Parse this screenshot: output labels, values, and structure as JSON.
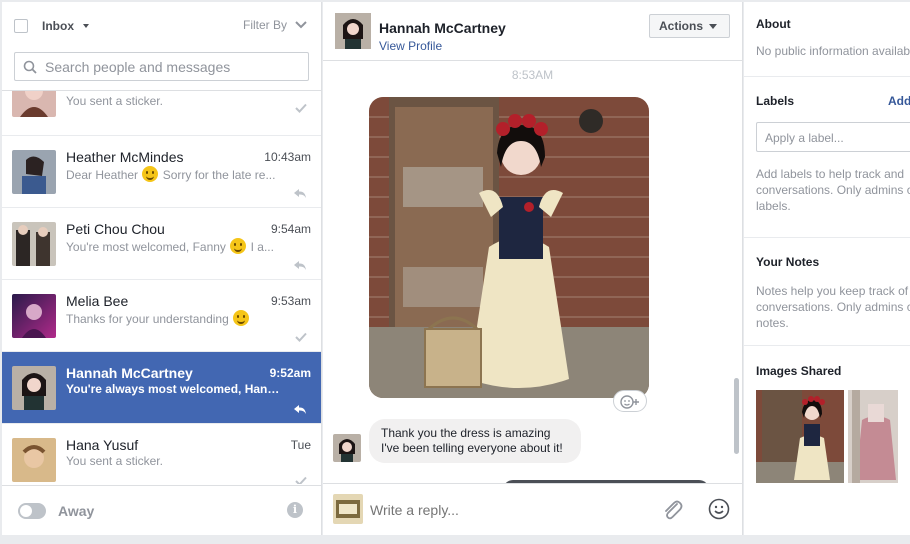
{
  "inbox": {
    "label": "Inbox",
    "filter_label": "Filter By",
    "search_placeholder": "Search people and messages",
    "threads": [
      {
        "name": "",
        "time": "",
        "preview": "You sent a sticker.",
        "status": "seen"
      },
      {
        "name": "Heather McMindes",
        "time": "10:43am",
        "preview_before": "Dear Heather",
        "preview_after": "Sorry for the late re...",
        "status": "replied"
      },
      {
        "name": "Peti Chou Chou",
        "time": "9:54am",
        "preview_before": "You're most welcomed, Fanny",
        "preview_after": "I a...",
        "status": "replied"
      },
      {
        "name": "Melia Bee",
        "time": "9:53am",
        "preview_before": "Thanks for your understanding",
        "preview_after": "",
        "status": "seen"
      },
      {
        "name": "Hannah McCartney",
        "time": "9:52am",
        "preview": "You're always most welcomed, Hann...",
        "status": "replied",
        "selected": true
      },
      {
        "name": "Hana Yusuf",
        "time": "Tue",
        "preview": "You sent a sticker.",
        "status": "seen"
      }
    ],
    "away_label": "Away"
  },
  "conversation": {
    "name": "Hannah McCartney",
    "view_profile": "View Profile",
    "actions_label": "Actions",
    "timestamp": "8:53AM",
    "message_line1": "Thank you the dress is amazing",
    "message_line2": "I've been telling everyone about it!",
    "reply_placeholder": "Write a reply..."
  },
  "details": {
    "about_title": "About",
    "about_text": "No public information available",
    "labels_title": "Labels",
    "labels_add": "Add",
    "label_placeholder": "Apply a label...",
    "labels_help_1": "Add labels to help track and",
    "labels_help_2": "conversations. Only admins c",
    "labels_help_3": "labels.",
    "notes_title": "Your Notes",
    "notes_help_1": "Notes help you keep track of",
    "notes_help_2": "conversations. Only admins c",
    "notes_help_3": "notes.",
    "images_title": "Images Shared"
  },
  "colors": {
    "accent": "#4267b2",
    "link": "#365899"
  }
}
